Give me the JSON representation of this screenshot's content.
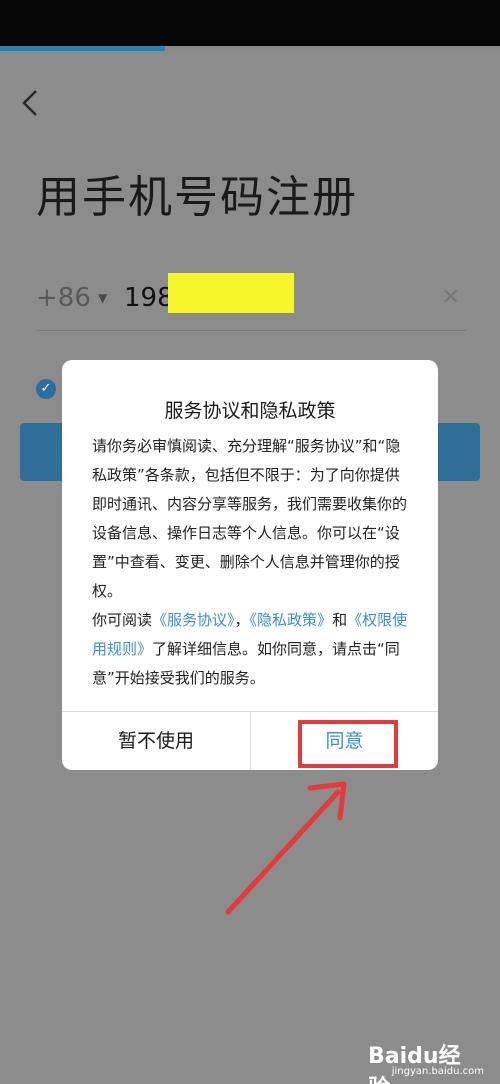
{
  "page": {
    "title": "用手机号码注册",
    "country_code": "+86",
    "phone_value": "198",
    "back_icon": "chevron-left-icon",
    "clear_icon": "close-icon"
  },
  "dialog": {
    "title": "服务协议和隐私政策",
    "paragraph1": "请你务必审慎阅读、充分理解“服务协议”和“隐私政策”各条款，包括但不限于：为了向你提供即时通讯、内容分享等服务，我们需要收集你的设备信息、操作日志等个人信息。你可以在“设置”中查看、变更、删除个人信息并管理你的授权。",
    "p2_prefix": "你可阅读",
    "link_service": "《服务协议》",
    "p2_sep1": "，",
    "link_privacy": "《隐私政策》",
    "p2_and": "和",
    "link_permission": "《权限使用规则》",
    "p2_suffix": "了解详细信息。如你同意，请点击“同意”开始接受我们的服务。",
    "cancel_label": "暂不使用",
    "agree_label": "同意"
  },
  "watermark": {
    "main": "Baidu经验",
    "sub": "jingyan.baidu.com"
  },
  "colors": {
    "link": "#3b8ed0",
    "annotation": "#e33a3a",
    "redaction": "#f5f52a"
  }
}
